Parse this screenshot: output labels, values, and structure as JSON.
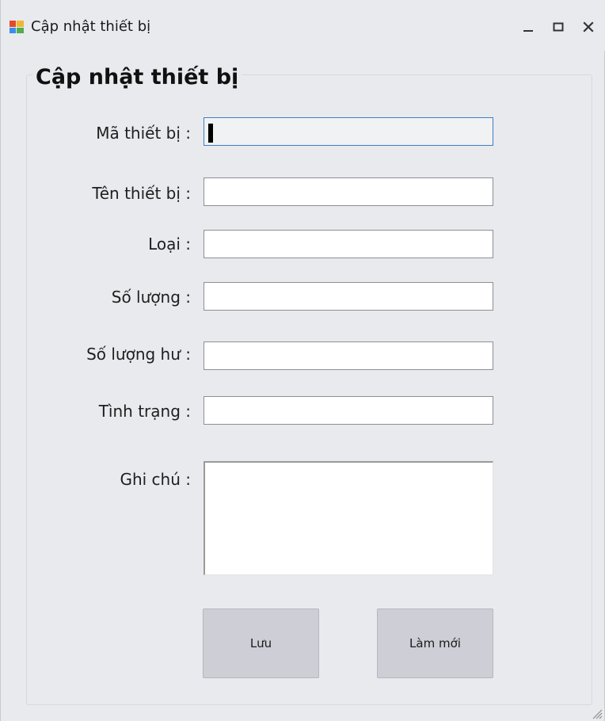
{
  "window": {
    "title": "Cập nhật thiết bị"
  },
  "form": {
    "group_title": "Cập nhật thiết bị",
    "fields": [
      {
        "label": "Mã thiết bị :",
        "value": ""
      },
      {
        "label": "Tên thiết bị :",
        "value": ""
      },
      {
        "label": "Loại :",
        "value": ""
      },
      {
        "label": "Số lượng :",
        "value": ""
      },
      {
        "label": "Số lượng hư :",
        "value": ""
      },
      {
        "label": "Tình trạng :",
        "value": ""
      },
      {
        "label": "Ghi chú :",
        "value": ""
      }
    ],
    "buttons": {
      "save_label": "Lưu",
      "reset_label": "Làm mới"
    }
  },
  "colors": {
    "window_bg": "#e9eaee",
    "button_bg": "#cdced6",
    "focus_border": "#3c7fc4"
  }
}
